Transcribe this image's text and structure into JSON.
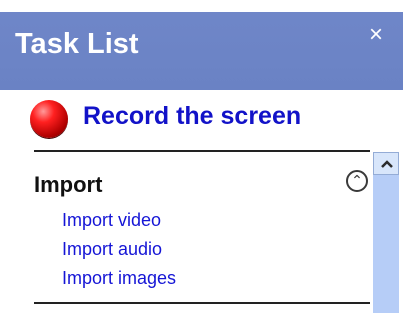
{
  "window": {
    "title": "Task List",
    "close_icon": "close-icon"
  },
  "record": {
    "icon": "record-dot-icon",
    "label": "Record the screen"
  },
  "import_section": {
    "title": "Import",
    "collapse_icon": "double-chevron-up-icon",
    "items": [
      {
        "label": "Import video"
      },
      {
        "label": "Import audio"
      },
      {
        "label": "Import images"
      }
    ]
  },
  "scrollbar": {
    "up_icon": "scroll-up-arrow-icon"
  },
  "colors": {
    "titlebar": "#6c84c6",
    "link": "#1515d6",
    "scrollbar": "#b8d0f8"
  }
}
